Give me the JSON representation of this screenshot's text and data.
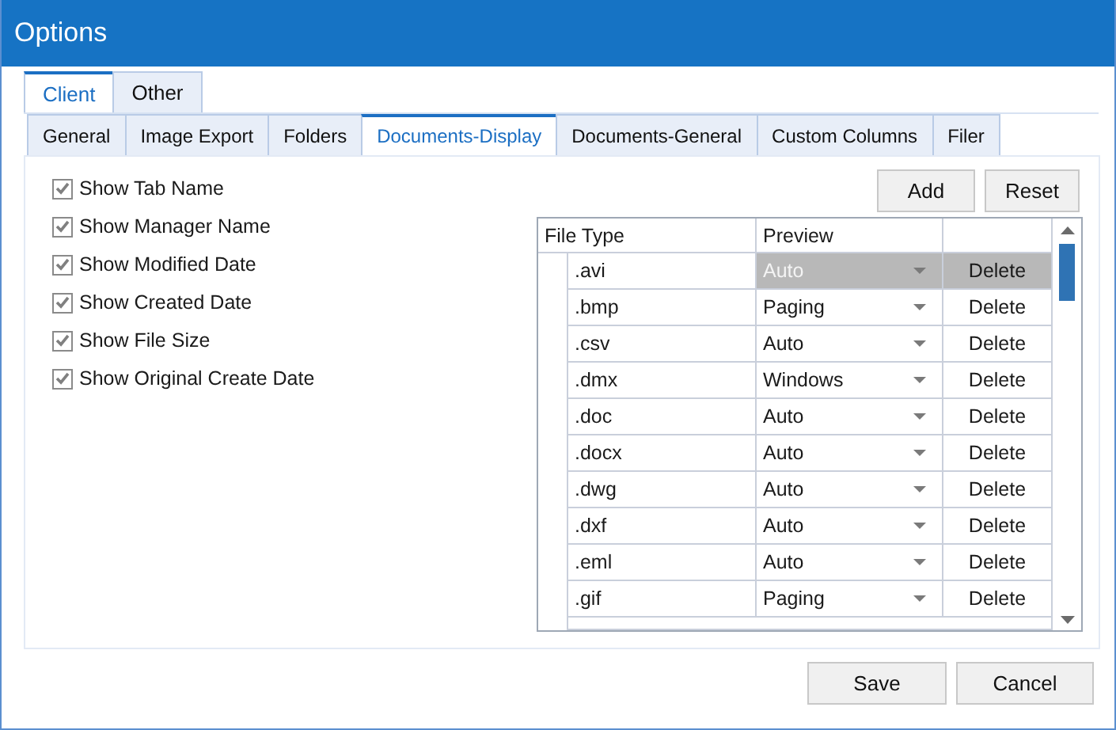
{
  "window": {
    "title": "Options"
  },
  "outer_tabs": [
    {
      "label": "Client",
      "selected": true
    },
    {
      "label": "Other",
      "selected": false
    }
  ],
  "inner_tabs": [
    {
      "label": "General",
      "selected": false
    },
    {
      "label": "Image Export",
      "selected": false
    },
    {
      "label": "Folders",
      "selected": false
    },
    {
      "label": "Documents-Display",
      "selected": true
    },
    {
      "label": "Documents-General",
      "selected": false
    },
    {
      "label": "Custom Columns",
      "selected": false
    },
    {
      "label": "Filer",
      "selected": false
    }
  ],
  "options": [
    {
      "label": "Show Tab Name",
      "checked": true
    },
    {
      "label": "Show Manager Name",
      "checked": true
    },
    {
      "label": "Show Modified Date",
      "checked": true
    },
    {
      "label": "Show Created Date",
      "checked": true
    },
    {
      "label": "Show File Size",
      "checked": true
    },
    {
      "label": "Show Original Create Date",
      "checked": true
    }
  ],
  "grid_buttons": [
    "Add",
    "Reset"
  ],
  "table": {
    "columns": [
      "File Type",
      "Preview"
    ],
    "rows": [
      {
        "file_type": ".avi",
        "preview": "Auto",
        "action": "Delete",
        "selected": true
      },
      {
        "file_type": ".bmp",
        "preview": "Paging",
        "action": "Delete",
        "selected": false
      },
      {
        "file_type": ".csv",
        "preview": "Auto",
        "action": "Delete",
        "selected": false
      },
      {
        "file_type": ".dmx",
        "preview": "Windows",
        "action": "Delete",
        "selected": false
      },
      {
        "file_type": ".doc",
        "preview": "Auto",
        "action": "Delete",
        "selected": false
      },
      {
        "file_type": ".docx",
        "preview": "Auto",
        "action": "Delete",
        "selected": false
      },
      {
        "file_type": ".dwg",
        "preview": "Auto",
        "action": "Delete",
        "selected": false
      },
      {
        "file_type": ".dxf",
        "preview": "Auto",
        "action": "Delete",
        "selected": false
      },
      {
        "file_type": ".eml",
        "preview": "Auto",
        "action": "Delete",
        "selected": false
      },
      {
        "file_type": ".gif",
        "preview": "Paging",
        "action": "Delete",
        "selected": false
      }
    ]
  },
  "footer_buttons": [
    "Save",
    "Cancel"
  ]
}
